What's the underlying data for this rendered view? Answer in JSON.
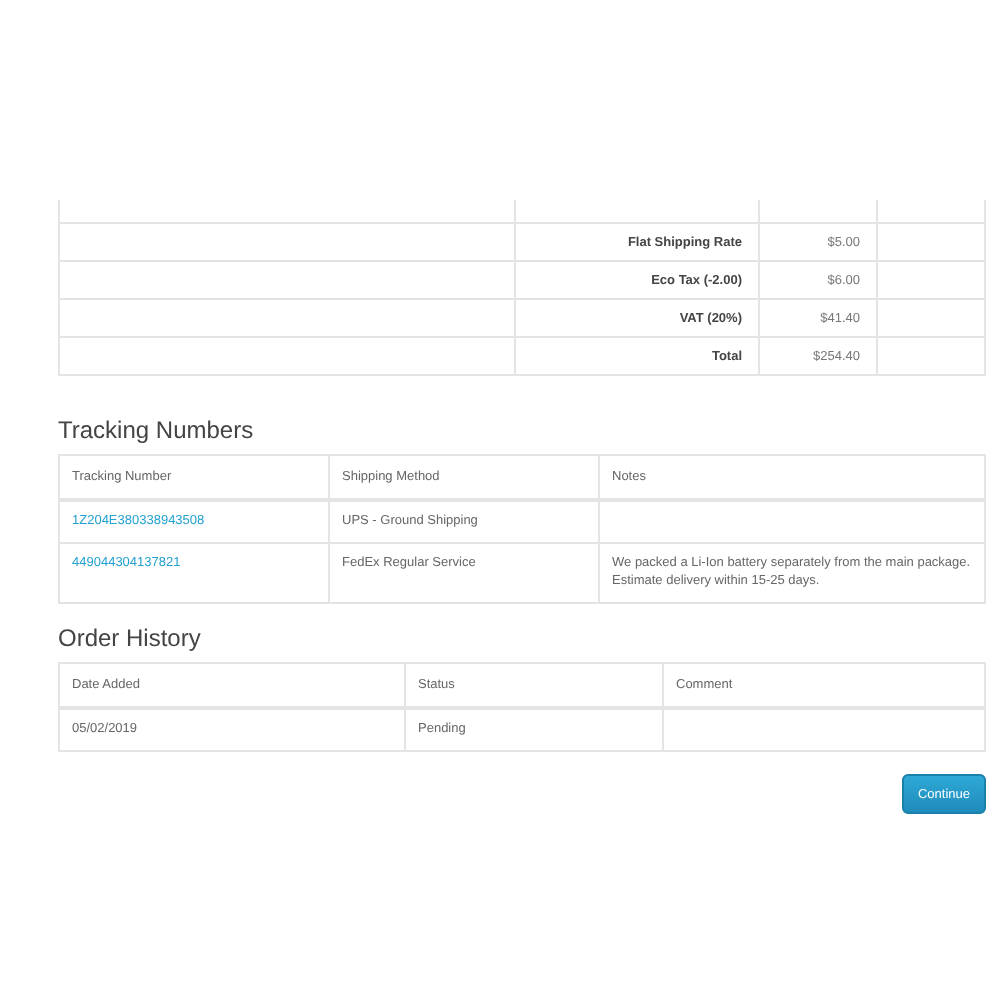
{
  "totals": [
    {
      "label": "Flat Shipping Rate",
      "value": "$5.00"
    },
    {
      "label": "Eco Tax (-2.00)",
      "value": "$6.00"
    },
    {
      "label": "VAT (20%)",
      "value": "$41.40"
    },
    {
      "label": "Total",
      "value": "$254.40"
    }
  ],
  "tracking": {
    "title": "Tracking Numbers",
    "columns": [
      "Tracking Number",
      "Shipping Method",
      "Notes"
    ],
    "rows": [
      {
        "tracking_number": "1Z204E380338943508",
        "shipping_method": "UPS - Ground Shipping",
        "notes": ""
      },
      {
        "tracking_number": "449044304137821",
        "shipping_method": "FedEx Regular Service",
        "notes": "We packed a Li-Ion battery separately from the main package. Estimate delivery within 15-25 days."
      }
    ]
  },
  "history": {
    "title": "Order History",
    "columns": [
      "Date Added",
      "Status",
      "Comment"
    ],
    "rows": [
      {
        "date_added": "05/02/2019",
        "status": "Pending",
        "comment": ""
      }
    ]
  },
  "continue_button": "Continue"
}
